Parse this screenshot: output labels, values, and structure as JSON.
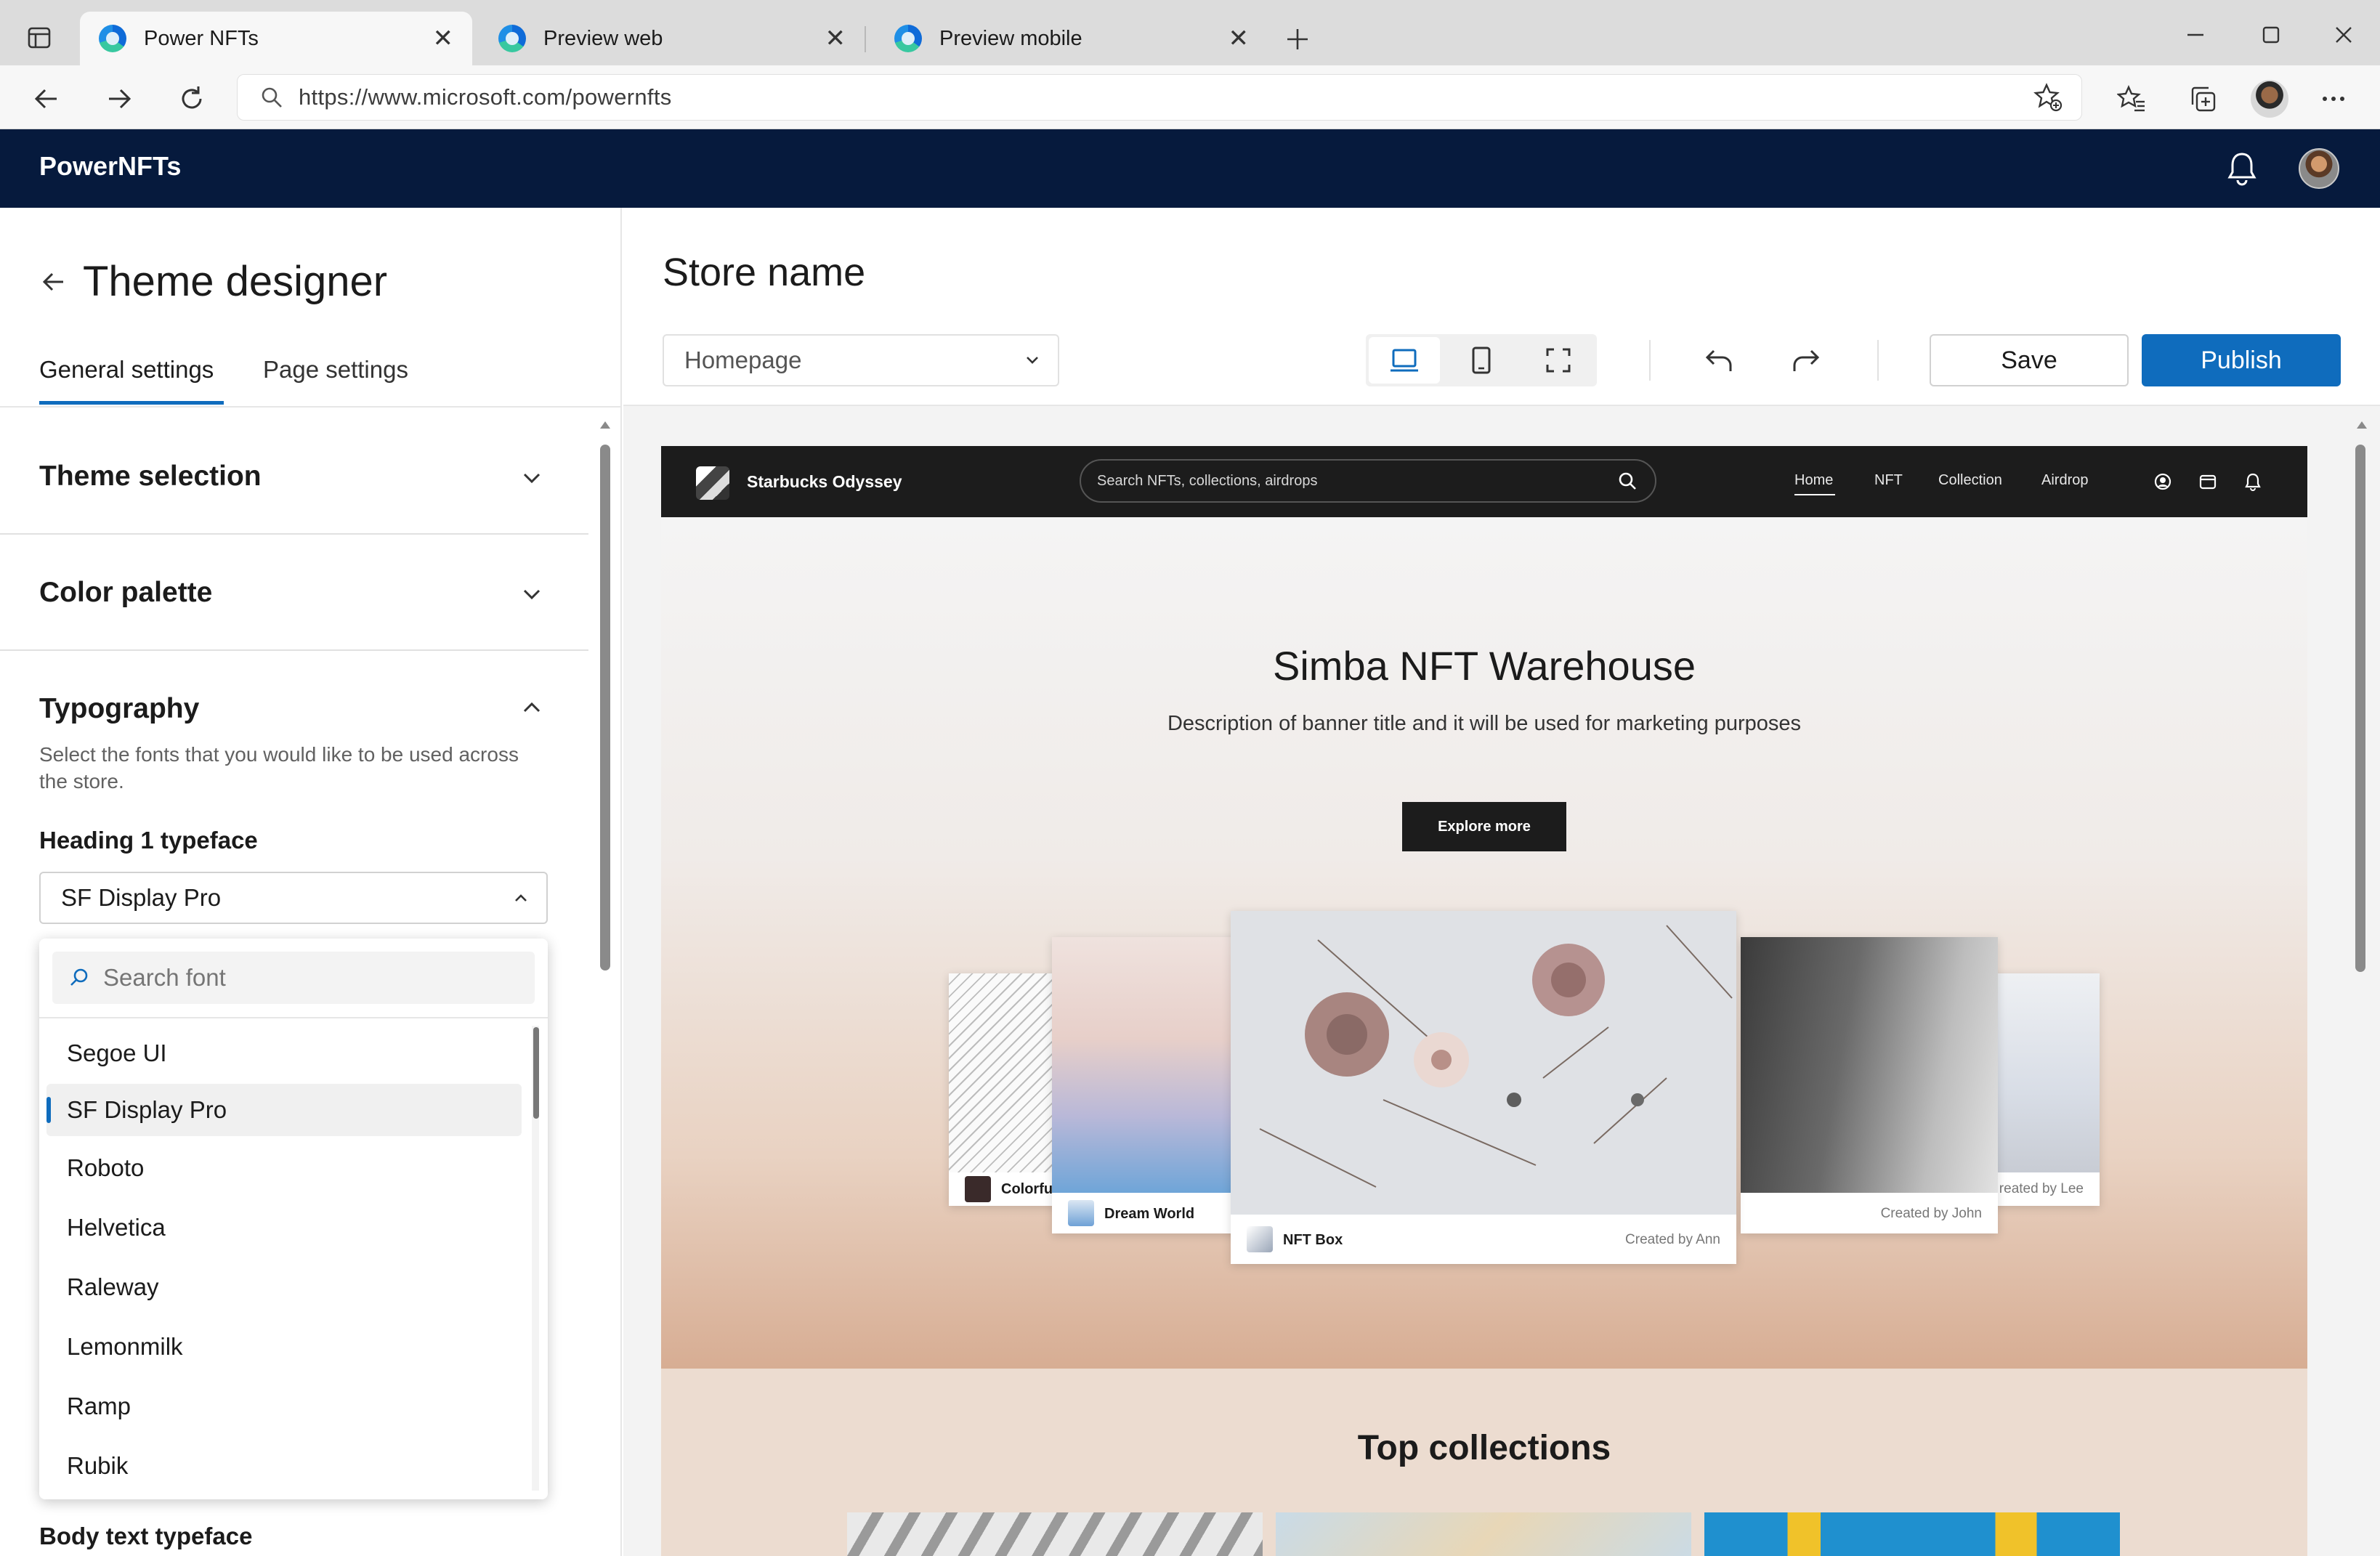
{
  "browser": {
    "tabs": [
      {
        "title": "Power NFTs",
        "active": true
      },
      {
        "title": "Preview web",
        "active": false
      },
      {
        "title": "Preview mobile",
        "active": false
      }
    ],
    "url": "https://www.microsoft.com/powernfts"
  },
  "app": {
    "brand": "PowerNFTs"
  },
  "left_panel": {
    "title": "Theme designer",
    "tabs": [
      {
        "label": "General settings",
        "active": true
      },
      {
        "label": "Page settings",
        "active": false
      }
    ],
    "sections": {
      "theme_selection": "Theme selection",
      "color_palette": "Color palette",
      "typography": "Typography"
    },
    "typography_description": "Select the fonts that you would like to be used across the store.",
    "heading1_label": "Heading 1 typeface",
    "heading1_value": "SF Display Pro",
    "search_placeholder": "Search font",
    "font_options": [
      "Segoe UI",
      "SF Display Pro",
      "Roboto",
      "Helvetica",
      "Raleway",
      "Lemonmilk",
      "Ramp",
      "Rubik"
    ],
    "selected_font": "SF Display Pro",
    "body_label": "Body text typeface"
  },
  "editor": {
    "store_name": "Store name",
    "page_select": "Homepage",
    "save_label": "Save",
    "publish_label": "Publish",
    "accent_color": "#0f6cbd"
  },
  "preview": {
    "store_title": "Starbucks Odyssey",
    "search_placeholder": "Search NFTs, collections, airdrops",
    "nav": [
      "Home",
      "NFT",
      "Collection",
      "Airdrop"
    ],
    "hero_title": "Simba NFT Warehouse",
    "hero_desc": "Description of banner title and it will be used for marketing purposes",
    "explore_label": "Explore more",
    "cards": {
      "far_left": {
        "name": "Colorful S"
      },
      "left": {
        "name": "Dream World"
      },
      "center": {
        "name": "NFT Box",
        "creator": "Created by Ann"
      },
      "right": {
        "creator": "Created by John"
      },
      "far_right": {
        "creator": "reated by Lee"
      }
    },
    "section_title": "Top collections"
  }
}
